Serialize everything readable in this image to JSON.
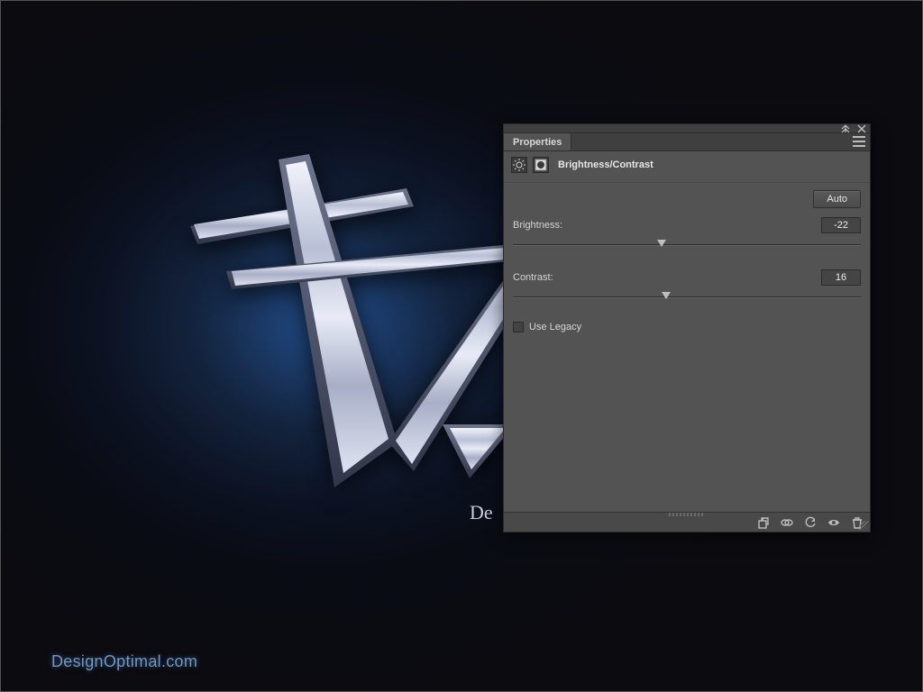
{
  "canvas": {
    "logo_subtext": "De",
    "watermark": "DesignOptimal.com"
  },
  "panel": {
    "tab": "Properties",
    "adjustment_title": "Brightness/Contrast",
    "auto_label": "Auto",
    "brightness": {
      "label": "Brightness:",
      "value": "-22",
      "range_min": -150,
      "range_max": 150
    },
    "contrast": {
      "label": "Contrast:",
      "value": "16",
      "range_min": -50,
      "range_max": 100
    },
    "use_legacy": {
      "label": "Use Legacy",
      "checked": false
    },
    "icons": {
      "collapse": "collapse-icon",
      "close": "close-icon",
      "menu": "panel-menu-icon",
      "adjustment": "brightness-adjustment-icon",
      "mask": "layer-mask-icon",
      "footer": {
        "clip": "clip-to-layer-icon",
        "view_previous": "view-previous-state-icon",
        "reset": "reset-icon",
        "visibility": "visibility-eye-icon",
        "delete": "delete-trash-icon"
      }
    }
  }
}
